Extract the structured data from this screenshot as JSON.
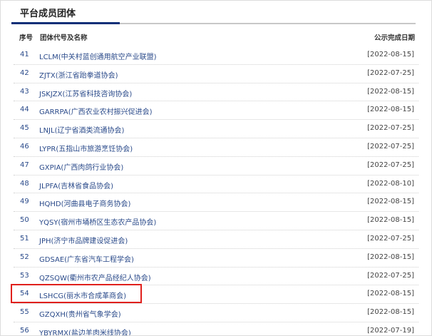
{
  "section": {
    "title": "平台成员团体"
  },
  "columns": {
    "no": "序号",
    "name": "团体代号及名称",
    "date": "公示完成日期"
  },
  "rows": [
    {
      "no": "41",
      "name": "LCLM(中关村蓝创通用航空产业联盟)",
      "date": "[2022-08-15]"
    },
    {
      "no": "42",
      "name": "ZJTX(浙江省跆拳道协会)",
      "date": "[2022-07-25]"
    },
    {
      "no": "43",
      "name": "JSKJZX(江苏省科技咨询协会)",
      "date": "[2022-08-15]"
    },
    {
      "no": "44",
      "name": "GARRPA(广西农业农村振兴促进会)",
      "date": "[2022-08-15]"
    },
    {
      "no": "45",
      "name": "LNJL(辽宁省酒类流通协会)",
      "date": "[2022-07-25]"
    },
    {
      "no": "46",
      "name": "LYPR(五指山市旅游烹饪协会)",
      "date": "[2022-07-25]"
    },
    {
      "no": "47",
      "name": "GXPIA(广西肉鸽行业协会)",
      "date": "[2022-07-25]"
    },
    {
      "no": "48",
      "name": "JLPFA(吉林省食品协会)",
      "date": "[2022-08-10]"
    },
    {
      "no": "49",
      "name": "HQHD(河曲县电子商务协会)",
      "date": "[2022-08-15]"
    },
    {
      "no": "50",
      "name": "YQSY(宿州市埇桥区生态农产品协会)",
      "date": "[2022-08-15]"
    },
    {
      "no": "51",
      "name": "JPH(济宁市品牌建设促进会)",
      "date": "[2022-07-25]"
    },
    {
      "no": "52",
      "name": "GDSAE(广东省汽车工程学会)",
      "date": "[2022-08-15]"
    },
    {
      "no": "53",
      "name": "QZSQW(衢州市农产品经纪人协会)",
      "date": "[2022-07-25]"
    },
    {
      "no": "54",
      "name": "LSHCG(丽水市合成革商会)",
      "date": "[2022-08-15]"
    },
    {
      "no": "55",
      "name": "GZQXH(贵州省气象学会)",
      "date": "[2022-08-15]"
    },
    {
      "no": "56",
      "name": "YBYRMX(盐边羊肉米线协会)",
      "date": "[2022-07-19]"
    }
  ],
  "colors": {
    "accent": "#0f2f78",
    "link": "#2a4a8a",
    "highlight_border": "#e0201c"
  }
}
